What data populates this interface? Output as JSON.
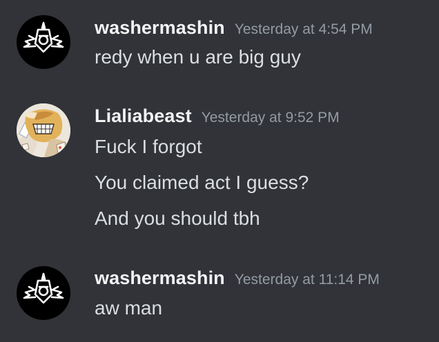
{
  "messages": [
    {
      "username": "washermashin",
      "timestamp": "Yesterday at 4:54 PM",
      "avatar_icon": "black-logo-avatar",
      "lines": [
        "redy when u are big guy"
      ]
    },
    {
      "username": "Lialiabeast",
      "timestamp": "Yesterday at 9:52 PM",
      "avatar_icon": "anime-character-avatar",
      "lines": [
        "Fuck I forgot",
        "You claimed act I guess?",
        "And you should tbh"
      ]
    },
    {
      "username": "washermashin",
      "timestamp": "Yesterday at 11:14 PM",
      "avatar_icon": "black-logo-avatar",
      "lines": [
        "aw man"
      ]
    }
  ],
  "colors": {
    "background": "#313338",
    "username": "#f2f3f5",
    "timestamp": "#949ba4",
    "text": "#dbdee1"
  }
}
